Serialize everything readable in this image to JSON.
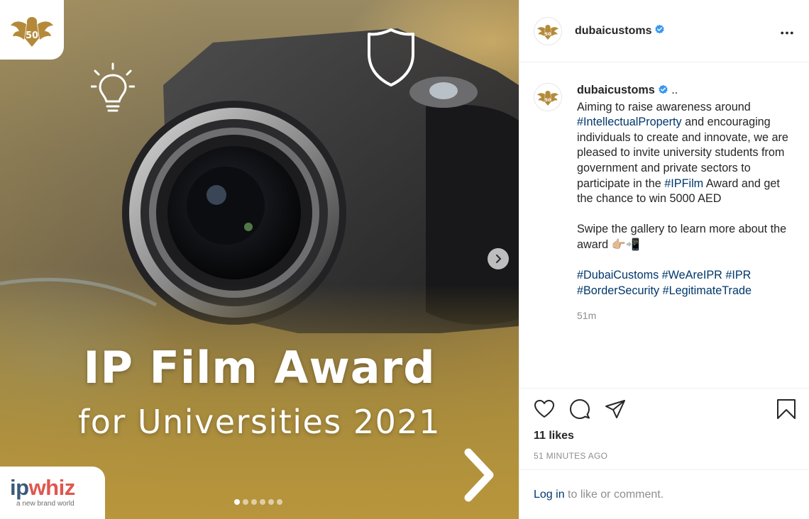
{
  "media": {
    "headline_line1": "IP Film Award",
    "headline_line2": "for Universities 2021",
    "sponsor_logo": {
      "word_part1": "ip",
      "word_part2": "whiz",
      "tagline": "a new brand world"
    },
    "brand_emblem_icon": "falcon-50-emblem-icon",
    "icons": [
      "lightbulb-icon",
      "shield-icon",
      "chevron-right-icon"
    ],
    "carousel": {
      "total": 6,
      "active_index": 0
    },
    "colors": {
      "overlay_gold": "#b8953c",
      "headline_text": "#ffffff"
    }
  },
  "header": {
    "username": "dubaicustoms",
    "verified": true
  },
  "caption": {
    "username": "dubaicustoms",
    "ellipsis": " ..",
    "seg1": "Aiming to raise awareness around ",
    "tag_ip": "#IntellectualProperty",
    "seg2": " and encouraging individuals to create and innovate, we are pleased to invite university students from government and private sectors to participate in the ",
    "tag_film": "#IPFilm",
    "seg3": " Award and get the chance to win 5000 AED",
    "swipe": "Swipe the gallery to learn more about the award 👉🏼📲",
    "tag_dc": "#DubaiCustoms",
    "tag_weare": "#WeAreIPR",
    "tag_ipr": "#IPR",
    "tag_border": "#BorderSecurity",
    "tag_legit": "#LegitimateTrade",
    "time": "51m"
  },
  "actions": {
    "likes": "11 likes",
    "posted": "51 MINUTES AGO",
    "icons": [
      "heart-icon",
      "comment-icon",
      "share-icon",
      "bookmark-icon"
    ]
  },
  "login": {
    "link": "Log in",
    "rest": " to like or comment."
  },
  "colors": {
    "hashtag": "#00376b",
    "verified_badge": "#3897f0",
    "muted_text": "#8e8e8e"
  }
}
